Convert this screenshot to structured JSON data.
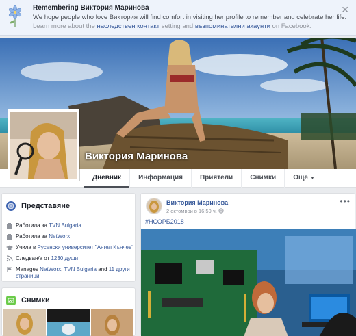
{
  "banner": {
    "title": "Remembering Виктория Маринова",
    "description": "We hope people who love Виктория will find comfort in visiting her profile to remember and celebrate her life.",
    "learn_prefix": "Learn more about the",
    "learn_link1": "наследствен контакт",
    "learn_middle": "setting and",
    "learn_link2": "възпоминателни акаунти",
    "learn_suffix": "on Facebook.",
    "close": "✕"
  },
  "profile": {
    "name": "Виктория Маринова"
  },
  "nav": {
    "tabs": [
      {
        "label": "Дневник"
      },
      {
        "label": "Информация"
      },
      {
        "label": "Приятели"
      },
      {
        "label": "Снимки"
      },
      {
        "label": "Още"
      }
    ],
    "more_caret": "▼"
  },
  "intro": {
    "title": "Представяне",
    "rows": [
      {
        "pre": "Работила за ",
        "link": "TVN Bulgaria",
        "post": ""
      },
      {
        "pre": "Работила за ",
        "link": "NetWorx",
        "post": ""
      },
      {
        "pre": "Учила в ",
        "link": "Русенски университет \"Ангел Кънчев\"",
        "post": ""
      },
      {
        "pre": "Следван/а от ",
        "link": "1230 души",
        "post": ""
      },
      {
        "pre": "Manages ",
        "link": "NetWorx",
        "post": ", ",
        "link2": "TVN Bulgaria",
        "post2": " and ",
        "link3": "11 други страници"
      }
    ]
  },
  "photos": {
    "title": "Снимки"
  },
  "post": {
    "author": "Виктория Маринова",
    "time": "2 октомври в 16:59 ч.",
    "privacy_icon": "globe-icon",
    "tag": "#НСОРБ2018",
    "options": "•••"
  },
  "colors": {
    "link": "#365899",
    "banner_bg": "#eef3fb",
    "page_bg": "#e9ebee"
  }
}
